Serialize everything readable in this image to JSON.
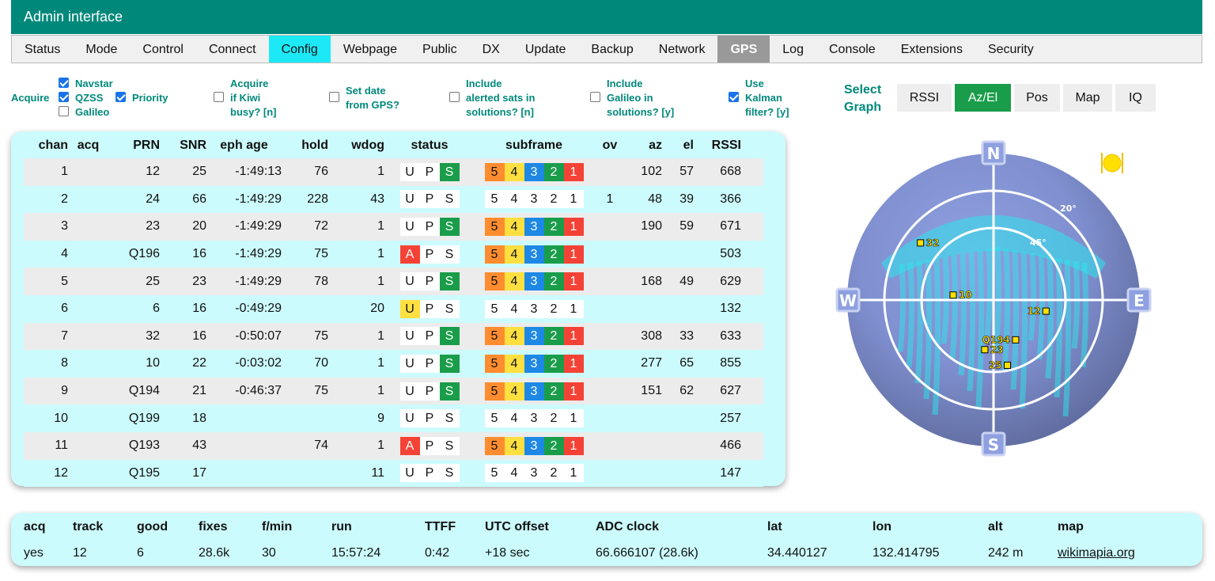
{
  "header": {
    "title": "Admin interface"
  },
  "tabs": [
    {
      "label": "Status"
    },
    {
      "label": "Mode"
    },
    {
      "label": "Control"
    },
    {
      "label": "Connect"
    },
    {
      "label": "Config",
      "state": "highlighted"
    },
    {
      "label": "Webpage"
    },
    {
      "label": "Public"
    },
    {
      "label": "DX"
    },
    {
      "label": "Update"
    },
    {
      "label": "Backup"
    },
    {
      "label": "Network"
    },
    {
      "label": "GPS",
      "state": "selected"
    },
    {
      "label": "Log"
    },
    {
      "label": "Console"
    },
    {
      "label": "Extensions"
    },
    {
      "label": "Security"
    }
  ],
  "options": {
    "acquire_label": "Acquire",
    "navstar": {
      "label": "Navstar",
      "checked": true
    },
    "qzss": {
      "label": "QZSS",
      "checked": true
    },
    "priority": {
      "label": "Priority",
      "checked": true
    },
    "galileo": {
      "label": "Galileo",
      "checked": false
    },
    "acquire_busy": {
      "line1": "Acquire",
      "line2": "if Kiwi",
      "line3": "busy? [n]",
      "checked": false
    },
    "set_date": {
      "line1": "Set date",
      "line2": "from GPS?",
      "checked": false
    },
    "include_alerted": {
      "line1": "Include",
      "line2": "alerted sats in",
      "line3": "solutions? [n]",
      "checked": false
    },
    "include_galileo": {
      "line1": "Include",
      "line2": "Galileo in",
      "line3": "solutions? [y]",
      "checked": false
    },
    "kalman": {
      "line1": "Use",
      "line2": "Kalman",
      "line3": "filter? [y]",
      "checked": true
    }
  },
  "graph": {
    "label_line1": "Select",
    "label_line2": "Graph",
    "buttons": [
      {
        "label": "RSSI",
        "active": false
      },
      {
        "label": "Az/El",
        "active": true
      },
      {
        "label": "Pos",
        "active": false
      },
      {
        "label": "Map",
        "active": false
      },
      {
        "label": "IQ",
        "active": false
      }
    ]
  },
  "table": {
    "headers": [
      "chan",
      "acq",
      "PRN",
      "SNR",
      "eph age",
      "hold",
      "wdog",
      "status",
      "subframe",
      "ov",
      "az",
      "el",
      "RSSI"
    ],
    "rows": [
      {
        "chan": "1",
        "acq": "",
        "prn": "12",
        "snr": "25",
        "eph": "-1:49:13",
        "hold": "76",
        "wdog": "1",
        "st": [
          "wb",
          "wb",
          "g"
        ],
        "sf": true,
        "ov": "",
        "az": "102",
        "el": "57",
        "rssi": "668"
      },
      {
        "chan": "2",
        "acq": "",
        "prn": "24",
        "snr": "66",
        "eph": "-1:49:29",
        "hold": "228",
        "wdog": "43",
        "st": [
          "wb",
          "wb",
          "wb"
        ],
        "sf": false,
        "ov": "1",
        "az": "48",
        "el": "39",
        "rssi": "366"
      },
      {
        "chan": "3",
        "acq": "",
        "prn": "23",
        "snr": "20",
        "eph": "-1:49:29",
        "hold": "72",
        "wdog": "1",
        "st": [
          "wb",
          "wb",
          "g"
        ],
        "sf": true,
        "ov": "",
        "az": "190",
        "el": "59",
        "rssi": "671"
      },
      {
        "chan": "4",
        "acq": "",
        "prn": "Q196",
        "snr": "16",
        "eph": "-1:49:29",
        "hold": "75",
        "wdog": "1",
        "st": [
          "red",
          "wb",
          "wb"
        ],
        "sf": true,
        "ov": "",
        "az": "",
        "el": "",
        "rssi": "503"
      },
      {
        "chan": "5",
        "acq": "",
        "prn": "25",
        "snr": "23",
        "eph": "-1:49:29",
        "hold": "78",
        "wdog": "1",
        "st": [
          "wb",
          "wb",
          "g"
        ],
        "sf": true,
        "ov": "",
        "az": "168",
        "el": "49",
        "rssi": "629"
      },
      {
        "chan": "6",
        "acq": "",
        "prn": "6",
        "snr": "16",
        "eph": "-0:49:29",
        "hold": "",
        "wdog": "20",
        "st": [
          "yel",
          "wb",
          "wb"
        ],
        "sf": false,
        "ov": "",
        "az": "",
        "el": "",
        "rssi": "132"
      },
      {
        "chan": "7",
        "acq": "",
        "prn": "32",
        "snr": "16",
        "eph": "-0:50:07",
        "hold": "75",
        "wdog": "1",
        "st": [
          "wb",
          "wb",
          "g"
        ],
        "sf": true,
        "ov": "",
        "az": "308",
        "el": "33",
        "rssi": "633"
      },
      {
        "chan": "8",
        "acq": "",
        "prn": "10",
        "snr": "22",
        "eph": "-0:03:02",
        "hold": "70",
        "wdog": "1",
        "st": [
          "wb",
          "wb",
          "g"
        ],
        "sf": true,
        "ov": "",
        "az": "277",
        "el": "65",
        "rssi": "855"
      },
      {
        "chan": "9",
        "acq": "",
        "prn": "Q194",
        "snr": "21",
        "eph": "-0:46:37",
        "hold": "75",
        "wdog": "1",
        "st": [
          "wb",
          "wb",
          "g"
        ],
        "sf": true,
        "ov": "",
        "az": "151",
        "el": "62",
        "rssi": "627"
      },
      {
        "chan": "10",
        "acq": "",
        "prn": "Q199",
        "snr": "18",
        "eph": "",
        "hold": "",
        "wdog": "9",
        "st": [
          "wb",
          "wb",
          "wb"
        ],
        "sf": false,
        "ov": "",
        "az": "",
        "el": "",
        "rssi": "257"
      },
      {
        "chan": "11",
        "acq": "",
        "prn": "Q193",
        "snr": "43",
        "eph": "",
        "hold": "74",
        "wdog": "1",
        "st": [
          "red",
          "wb",
          "wb"
        ],
        "sf": true,
        "ov": "",
        "az": "",
        "el": "",
        "rssi": "466"
      },
      {
        "chan": "12",
        "acq": "",
        "prn": "Q195",
        "snr": "17",
        "eph": "",
        "hold": "",
        "wdog": "11",
        "st": [
          "wb",
          "wb",
          "wb"
        ],
        "sf": false,
        "ov": "",
        "az": "",
        "el": "",
        "rssi": "147"
      }
    ],
    "status_letters": [
      "U",
      "P",
      "S"
    ],
    "acq_letter": "A",
    "subframe_labels": [
      "5",
      "4",
      "3",
      "2",
      "1"
    ]
  },
  "skyplot": {
    "compass": {
      "n": "N",
      "e": "E",
      "s": "S",
      "w": "W"
    },
    "ring_labels": [
      "20°",
      "45°"
    ],
    "sats": [
      {
        "prn": "32",
        "az": 308,
        "el": 33
      },
      {
        "prn": "10",
        "az": 277,
        "el": 65
      },
      {
        "prn": "12",
        "az": 102,
        "el": 57
      },
      {
        "prn": "Q194",
        "az": 151,
        "el": 62
      },
      {
        "prn": "23",
        "az": 190,
        "el": 59
      },
      {
        "prn": "25",
        "az": 168,
        "el": 49
      }
    ]
  },
  "stats": {
    "headers": [
      "acq",
      "track",
      "good",
      "fixes",
      "f/min",
      "run",
      "TTFF",
      "UTC offset",
      "ADC clock",
      "lat",
      "lon",
      "alt",
      "map"
    ],
    "values": [
      "yes",
      "12",
      "6",
      "28.6k",
      "30",
      "15:57:24",
      "0:42",
      "+18 sec",
      "66.666107 (28.6k)",
      "34.440127",
      "132.414795",
      "242 m",
      "wikimapia.org"
    ]
  }
}
